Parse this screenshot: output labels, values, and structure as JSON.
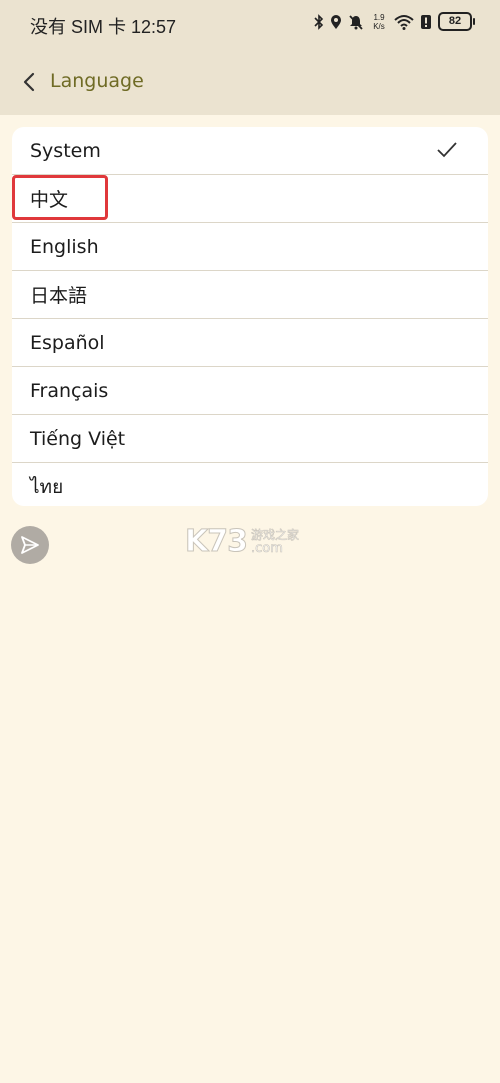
{
  "status_bar": {
    "left_text": "没有 SIM 卡 12:57",
    "network_speed_value": "1.9",
    "network_speed_unit": "K/s",
    "battery_level": "82",
    "icons": [
      "bluetooth-icon",
      "location-icon",
      "mute-icon",
      "wifi-icon",
      "alert-icon",
      "battery-icon"
    ]
  },
  "header": {
    "title": "Language"
  },
  "languages": {
    "items": [
      {
        "label": "System",
        "selected": true
      },
      {
        "label": "中文",
        "selected": false,
        "highlighted": true
      },
      {
        "label": "English",
        "selected": false
      },
      {
        "label": "日本語",
        "selected": false
      },
      {
        "label": "Español",
        "selected": false
      },
      {
        "label": "Français",
        "selected": false
      },
      {
        "label": "Tiếng Việt",
        "selected": false
      },
      {
        "label": "ไทย",
        "selected": false
      }
    ]
  },
  "watermark": {
    "main": "K73",
    "sub_cn": "游戏之家",
    "sub_com": ".com"
  },
  "colors": {
    "background": "#fdf6e6",
    "header_background": "#ebe3d0",
    "title_color": "#6f6b25",
    "highlight": "#e0383b"
  }
}
